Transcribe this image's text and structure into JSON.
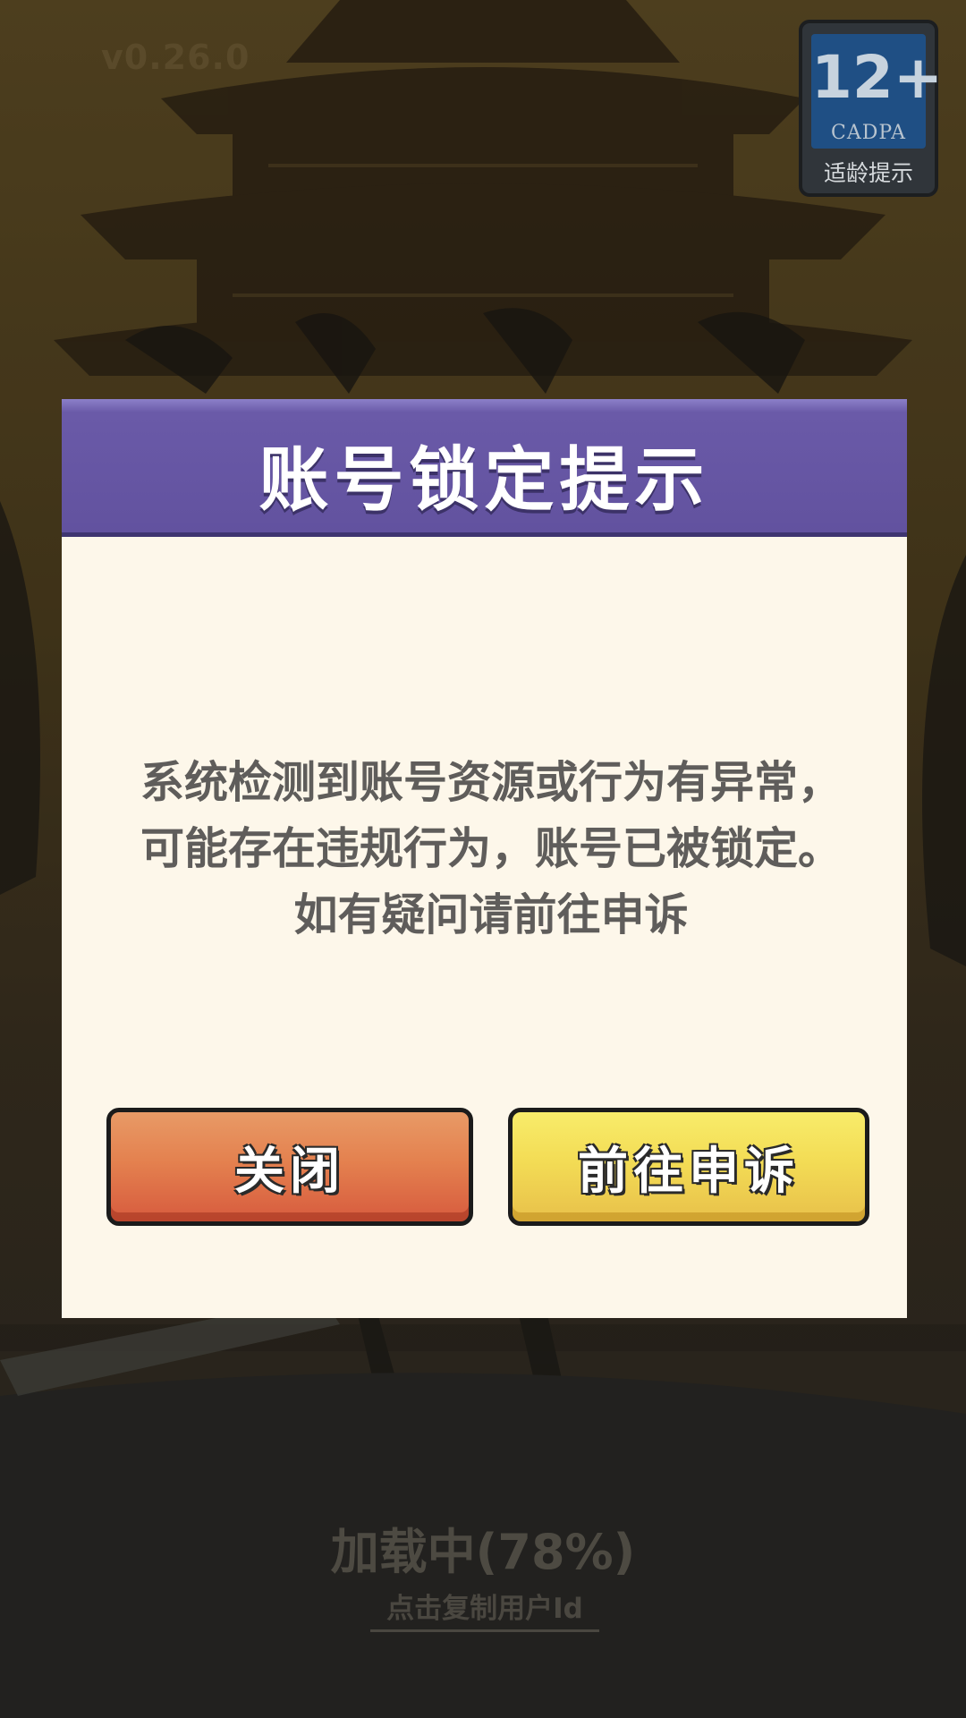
{
  "header": {
    "version": "v0.26.0",
    "age_rating": {
      "age": "12+",
      "org": "CADPA",
      "tip": "适龄提示"
    }
  },
  "dialog": {
    "title": "账号锁定提示",
    "message": "系统检测到账号资源或行为有异常，可能存在违规行为，账号已被锁定。如有疑问请前往申诉",
    "close_label": "关闭",
    "appeal_label": "前往申诉"
  },
  "footer": {
    "loading_text": "加载中(78%)",
    "copy_id_label": "点击复制用户Id"
  },
  "colors": {
    "dialog_header": "#62529f",
    "dialog_body": "#fdf7ea",
    "close_button": "#e4814f",
    "appeal_button": "#f3dc55"
  }
}
